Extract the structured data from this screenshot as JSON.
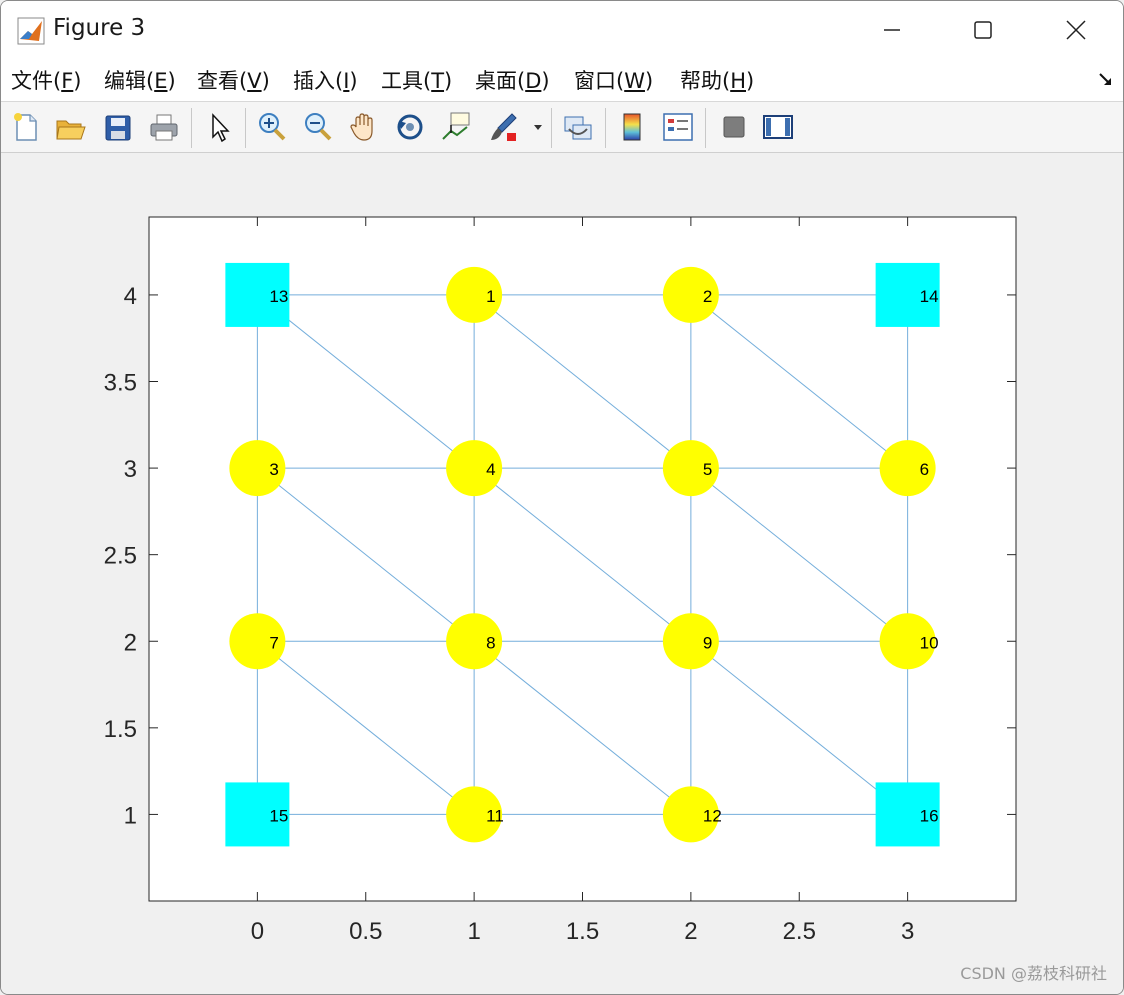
{
  "window": {
    "title": "Figure 3",
    "app_icon": "matlab-icon",
    "controls": {
      "minimize": "minimize-icon",
      "maximize": "maximize-icon",
      "close": "close-icon"
    }
  },
  "menubar": {
    "items": [
      {
        "label": "文件(",
        "acc": "F",
        "tail": ")"
      },
      {
        "label": "编辑(",
        "acc": "E",
        "tail": ")"
      },
      {
        "label": "查看(",
        "acc": "V",
        "tail": ")"
      },
      {
        "label": "插入(",
        "acc": "I",
        "tail": ")"
      },
      {
        "label": "工具(",
        "acc": "T",
        "tail": ")"
      },
      {
        "label": "桌面(",
        "acc": "D",
        "tail": ")"
      },
      {
        "label": "窗口(",
        "acc": "W",
        "tail": ")"
      },
      {
        "label": "帮助(",
        "acc": "H",
        "tail": ")"
      }
    ],
    "dock_icon": "dock-arrow-icon"
  },
  "toolbar": {
    "buttons": [
      "new-figure-icon",
      "open-file-icon",
      "save-icon",
      "print-icon",
      "select-pointer-icon",
      "zoom-in-icon",
      "zoom-out-icon",
      "pan-hand-icon",
      "rotate-3d-icon",
      "data-cursor-icon",
      "brush-icon",
      "brush-dropdown-icon",
      "link-plot-icon",
      "colorbar-icon",
      "legend-icon",
      "hide-plot-tools-icon",
      "show-plot-tools-icon"
    ]
  },
  "watermark": "CSDN @荔枝科研社",
  "chart_data": {
    "type": "scatter",
    "title": "",
    "xlabel": "",
    "ylabel": "",
    "xlim": [
      -0.5,
      3.5
    ],
    "ylim": [
      0.5,
      4.45
    ],
    "xticks": [
      "0",
      "0.5",
      "1",
      "1.5",
      "2",
      "2.5",
      "3"
    ],
    "xtick_values": [
      0,
      0.5,
      1,
      1.5,
      2,
      2.5,
      3
    ],
    "yticks": [
      "1",
      "1.5",
      "2",
      "2.5",
      "3",
      "3.5",
      "4"
    ],
    "ytick_values": [
      1,
      1.5,
      2,
      2.5,
      3,
      3.5,
      4
    ],
    "grid": false,
    "colors": {
      "circle": "#ffff00",
      "square": "#00ffff",
      "edge": "#74aedb"
    },
    "nodes": [
      {
        "id": "1",
        "x": 1,
        "y": 4,
        "shape": "circle"
      },
      {
        "id": "2",
        "x": 2,
        "y": 4,
        "shape": "circle"
      },
      {
        "id": "3",
        "x": 0,
        "y": 3,
        "shape": "circle"
      },
      {
        "id": "4",
        "x": 1,
        "y": 3,
        "shape": "circle"
      },
      {
        "id": "5",
        "x": 2,
        "y": 3,
        "shape": "circle"
      },
      {
        "id": "6",
        "x": 3,
        "y": 3,
        "shape": "circle"
      },
      {
        "id": "7",
        "x": 0,
        "y": 2,
        "shape": "circle"
      },
      {
        "id": "8",
        "x": 1,
        "y": 2,
        "shape": "circle"
      },
      {
        "id": "9",
        "x": 2,
        "y": 2,
        "shape": "circle"
      },
      {
        "id": "10",
        "x": 3,
        "y": 2,
        "shape": "circle"
      },
      {
        "id": "11",
        "x": 1,
        "y": 1,
        "shape": "circle"
      },
      {
        "id": "12",
        "x": 2,
        "y": 1,
        "shape": "circle"
      },
      {
        "id": "13",
        "x": 0,
        "y": 4,
        "shape": "square"
      },
      {
        "id": "14",
        "x": 3,
        "y": 4,
        "shape": "square"
      },
      {
        "id": "15",
        "x": 0,
        "y": 1,
        "shape": "square"
      },
      {
        "id": "16",
        "x": 3,
        "y": 1,
        "shape": "square"
      }
    ],
    "edges": [
      [
        "13",
        "1"
      ],
      [
        "1",
        "2"
      ],
      [
        "2",
        "14"
      ],
      [
        "3",
        "4"
      ],
      [
        "4",
        "5"
      ],
      [
        "5",
        "6"
      ],
      [
        "7",
        "8"
      ],
      [
        "8",
        "9"
      ],
      [
        "9",
        "10"
      ],
      [
        "15",
        "11"
      ],
      [
        "11",
        "12"
      ],
      [
        "12",
        "16"
      ],
      [
        "13",
        "3"
      ],
      [
        "3",
        "7"
      ],
      [
        "7",
        "15"
      ],
      [
        "1",
        "4"
      ],
      [
        "4",
        "8"
      ],
      [
        "8",
        "11"
      ],
      [
        "2",
        "5"
      ],
      [
        "5",
        "9"
      ],
      [
        "9",
        "12"
      ],
      [
        "14",
        "6"
      ],
      [
        "6",
        "10"
      ],
      [
        "10",
        "16"
      ],
      [
        "13",
        "4"
      ],
      [
        "1",
        "5"
      ],
      [
        "2",
        "6"
      ],
      [
        "3",
        "8"
      ],
      [
        "4",
        "9"
      ],
      [
        "5",
        "10"
      ],
      [
        "7",
        "11"
      ],
      [
        "8",
        "12"
      ],
      [
        "9",
        "16"
      ]
    ]
  }
}
